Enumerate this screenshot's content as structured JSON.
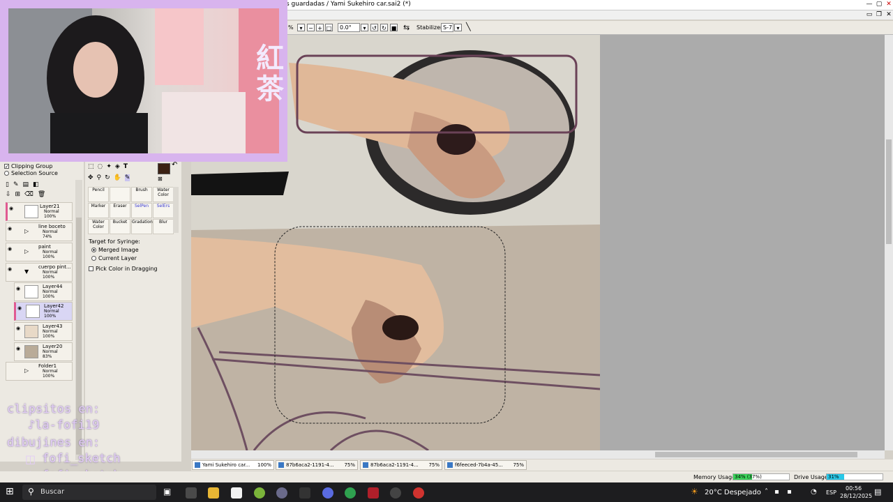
{
  "window": {
    "title": "s guardadas / Yami Sukehiro car.sai2 (*)"
  },
  "toolbar": {
    "zoom_suffix": "%",
    "angle_value": "0.0°",
    "stabilizer_label": "Stabilizer",
    "stabilizer_value": "S-7"
  },
  "overlay": {
    "kanji": "紅茶",
    "clips_label": "clipsitos en:",
    "clips_handle": "♪la-fofi19",
    "drawings_label": "dibujines en:",
    "instagram_handle": "fofi_sketch",
    "tiktok_handle": "fofi_sketch"
  },
  "left_panel": {
    "clipping_group": "Clipping Group",
    "selection_source": "Selection Source",
    "layers": [
      {
        "name": "Layer21",
        "mode": "Normal",
        "opacity": "100%"
      },
      {
        "name": "line boceto",
        "mode": "Normal",
        "opacity": "74%"
      },
      {
        "name": "paint",
        "mode": "Normal",
        "opacity": "100%"
      },
      {
        "name": "cuerpo pint...",
        "mode": "Normal",
        "opacity": "100%"
      },
      {
        "name": "Layer44",
        "mode": "Normal",
        "opacity": "100%"
      },
      {
        "name": "Layer42",
        "mode": "Normal",
        "opacity": "100%"
      },
      {
        "name": "Layer43",
        "mode": "Normal",
        "opacity": "100%"
      },
      {
        "name": "Layer20",
        "mode": "Normal",
        "opacity": "83%"
      },
      {
        "name": "Folder1",
        "mode": "Normal",
        "opacity": "100%"
      }
    ]
  },
  "tool_panel": {
    "brushes": [
      "Pencil",
      "",
      "Brush",
      "Water Color",
      "Marker",
      "Eraser",
      "SelPen",
      "SelErs",
      "Water Color",
      "Bucket",
      "Gradation",
      "Blur"
    ],
    "target_label": "Target for Syringe:",
    "option_merged": "Merged Image",
    "option_current": "Current Layer",
    "pick_color": "Pick Color in Dragging",
    "main_color": "#3b2114"
  },
  "tabs": [
    {
      "name": "Yami Sukehiro car...",
      "zoom": "100%"
    },
    {
      "name": "87b6aca2-1191-4...",
      "zoom": "75%"
    },
    {
      "name": "87b6aca2-1191-4...",
      "zoom": "75%"
    },
    {
      "name": "f6feeced-7b4a-45...",
      "zoom": "75%"
    }
  ],
  "status": {
    "memory_label": "Memory Usage",
    "memory_value": "34% (37%)",
    "drive_label": "Drive Usage",
    "drive_value": "31%",
    "memory_fraction": 0.34,
    "drive_fraction": 0.31
  },
  "taskbar": {
    "search_placeholder": "Buscar",
    "weather": "20°C Despejado",
    "lang": "ESP",
    "time": "00:56",
    "date": "28/12/2025"
  },
  "colors": {
    "accent": "#d8b4ee",
    "selected_layer": "#d9d6f4",
    "memory_bar": "#3ad35a",
    "drive_bar": "#28c8e8"
  }
}
